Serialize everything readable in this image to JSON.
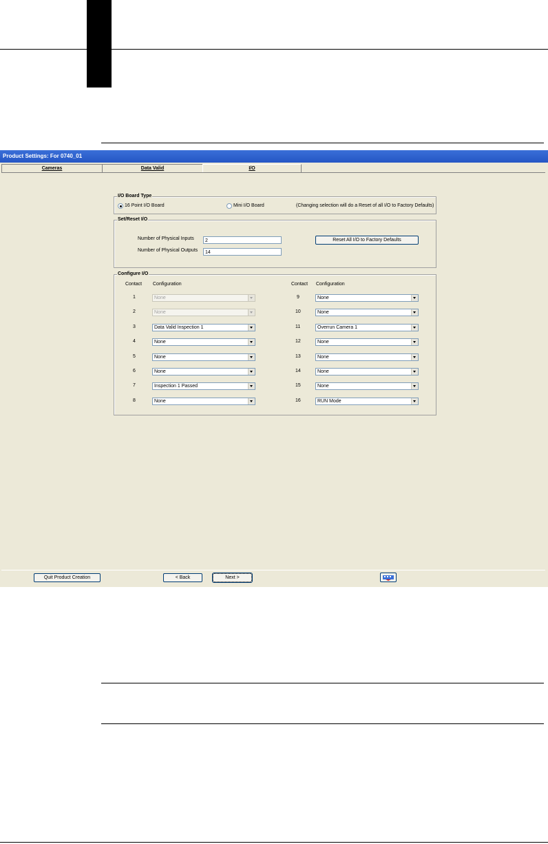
{
  "window": {
    "title": "Product Settings: For 0740_01"
  },
  "tabs": [
    {
      "label": "Cameras"
    },
    {
      "label": "Data Valid"
    },
    {
      "label": "I/O"
    }
  ],
  "io_board_type": {
    "title": "I/O Board Type",
    "option1": "16 Point I/O Board",
    "option2": "Mini I/O Board",
    "selected": "16 Point I/O Board",
    "note": "(Changing selection will do a Reset of all I/O to Factory Defaults)"
  },
  "set_reset": {
    "title": "Set/Reset I/O",
    "inputs_label": "Number of Physical Inputs",
    "inputs_value": "2",
    "outputs_label": "Number of Physical Outputs",
    "outputs_value": "14",
    "reset_button": "Reset All I/O to Factory Defaults"
  },
  "configure": {
    "title": "Configure I/O",
    "contact_header": "Contact",
    "config_header": "Configuration",
    "left": [
      {
        "contact": "1",
        "value": "None",
        "disabled": true
      },
      {
        "contact": "2",
        "value": "None",
        "disabled": true
      },
      {
        "contact": "3",
        "value": "Data Valid Inspection 1"
      },
      {
        "contact": "4",
        "value": "None"
      },
      {
        "contact": "5",
        "value": "None"
      },
      {
        "contact": "6",
        "value": "None"
      },
      {
        "contact": "7",
        "value": "Inspection 1 Passed"
      },
      {
        "contact": "8",
        "value": "None"
      }
    ],
    "right": [
      {
        "contact": "9",
        "value": "None"
      },
      {
        "contact": "10",
        "value": "None"
      },
      {
        "contact": "11",
        "value": "Overrun Camera 1"
      },
      {
        "contact": "12",
        "value": "None"
      },
      {
        "contact": "13",
        "value": "None"
      },
      {
        "contact": "14",
        "value": "None"
      },
      {
        "contact": "15",
        "value": "None"
      },
      {
        "contact": "16",
        "value": "RUN Mode"
      }
    ]
  },
  "footer": {
    "quit": "Quit Product Creation",
    "back": "< Back",
    "next": "Next >"
  },
  "icons": {
    "help": "help-keyboard-icon"
  },
  "colors": {
    "title_bar": "#2456c4",
    "window_bg": "#ece9d8"
  }
}
